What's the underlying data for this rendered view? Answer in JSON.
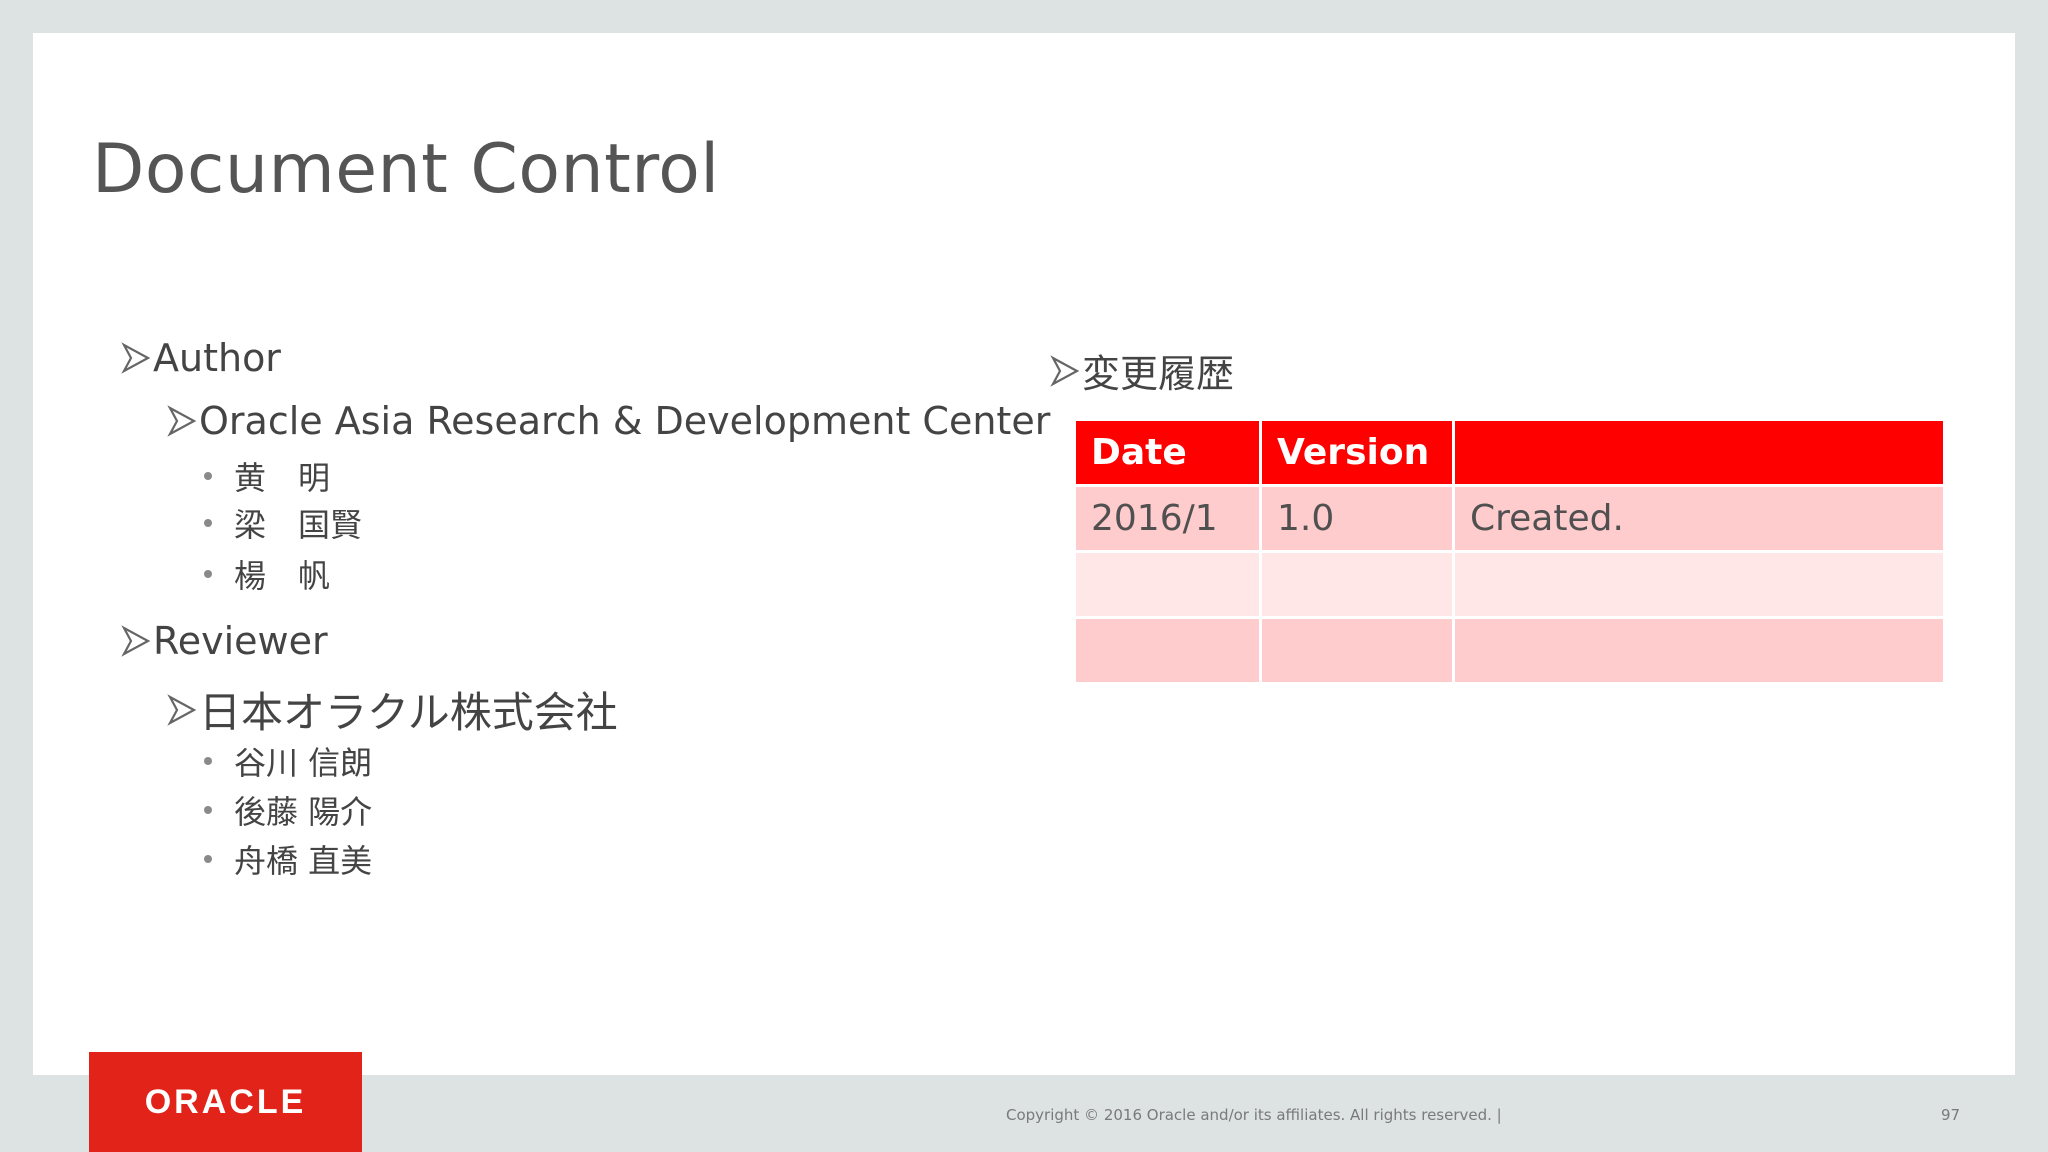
{
  "slide": {
    "title": "Document Control"
  },
  "author": {
    "heading": "Author",
    "org": "Oracle Asia Research & Development Center",
    "people": [
      "黄　明",
      "梁　国賢",
      "楊　帆"
    ]
  },
  "reviewer": {
    "heading": "Reviewer",
    "org": "日本オラクル株式会社",
    "people": [
      "谷川 信朗",
      "後藤 陽介",
      "舟橋 直美"
    ]
  },
  "history": {
    "heading": "変更履歴",
    "columns": [
      "Date",
      "Version",
      ""
    ],
    "rows": [
      [
        "2016/1",
        "1.0",
        "Created."
      ],
      [
        "",
        "",
        ""
      ],
      [
        "",
        "",
        ""
      ]
    ]
  },
  "footer": {
    "logo_text": "ORACLE",
    "copyright": "Copyright © 2016 Oracle and/or its affiliates. All rights reserved.  |",
    "page_number": "97"
  },
  "colors": {
    "header_red": "#ff0000",
    "row_pink": "#ffcccd",
    "row_light_pink": "#ffe7e8",
    "logo_red": "#e2231a"
  },
  "icons": {
    "bullet_level1": "arrowhead-bullet-icon",
    "bullet_level3": "dot-bullet-icon"
  }
}
